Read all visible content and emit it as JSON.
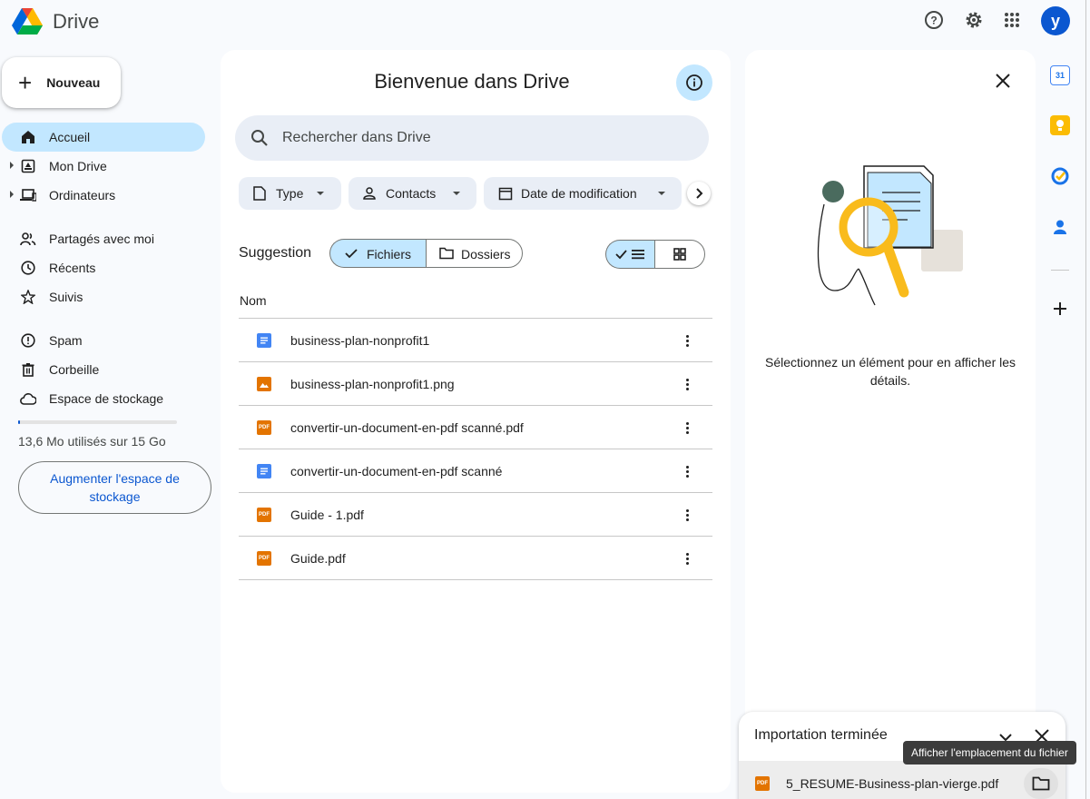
{
  "header": {
    "app_title": "Drive",
    "icons": [
      "help-icon",
      "settings-icon",
      "apps-grid-icon"
    ],
    "avatar_letter": "y"
  },
  "sidebar": {
    "new_label": "Nouveau",
    "items": [
      {
        "label": "Accueil",
        "icon": "home-icon",
        "active": true
      },
      {
        "label": "Mon Drive",
        "icon": "my-drive-icon",
        "expandable": true
      },
      {
        "label": "Ordinateurs",
        "icon": "computers-icon",
        "expandable": true
      },
      {
        "label": "Partagés avec moi",
        "icon": "shared-icon"
      },
      {
        "label": "Récents",
        "icon": "clock-icon"
      },
      {
        "label": "Suivis",
        "icon": "star-icon"
      },
      {
        "label": "Spam",
        "icon": "spam-icon"
      },
      {
        "label": "Corbeille",
        "icon": "trash-icon"
      },
      {
        "label": "Espace de stockage",
        "icon": "cloud-icon"
      }
    ],
    "storage_used_fraction": 0.01,
    "storage_text": "13,6 Mo utilisés sur 15 Go",
    "upgrade_label": "Augmenter l'espace de stockage"
  },
  "main": {
    "welcome": "Bienvenue dans Drive",
    "search_placeholder": "Rechercher dans Drive",
    "filters": [
      "Type",
      "Contacts",
      "Date de modification"
    ],
    "suggestion_label": "Suggestion",
    "toggle_files": "Fichiers",
    "toggle_folders": "Dossiers",
    "column_name": "Nom",
    "files": [
      {
        "name": "business-plan-nonprofit1",
        "type": "doc"
      },
      {
        "name": "business-plan-nonprofit1.png",
        "type": "image"
      },
      {
        "name": "convertir-un-document-en-pdf scanné.pdf",
        "type": "pdf"
      },
      {
        "name": "convertir-un-document-en-pdf scanné",
        "type": "doc"
      },
      {
        "name": "Guide - 1.pdf",
        "type": "pdf"
      },
      {
        "name": "Guide.pdf",
        "type": "pdf"
      }
    ]
  },
  "details": {
    "message": "Sélectionnez un élément pour en afficher les détails."
  },
  "rail": {
    "icons": [
      "calendar-icon",
      "keep-icon",
      "tasks-icon",
      "contacts-icon",
      "add-icon"
    ],
    "calendar_day": "31"
  },
  "toast": {
    "title": "Importation terminée",
    "file": "5_RESUME-Business-plan-vierge.pdf",
    "tooltip": "Afficher l'emplacement du fichier",
    "pdf_badge": "PDF"
  },
  "colors": {
    "accent": "#0b57d0",
    "active_bg": "#c2e7ff",
    "search_bg": "#e9eef6",
    "pdf": "#e37400",
    "doc": "#4285f4"
  }
}
